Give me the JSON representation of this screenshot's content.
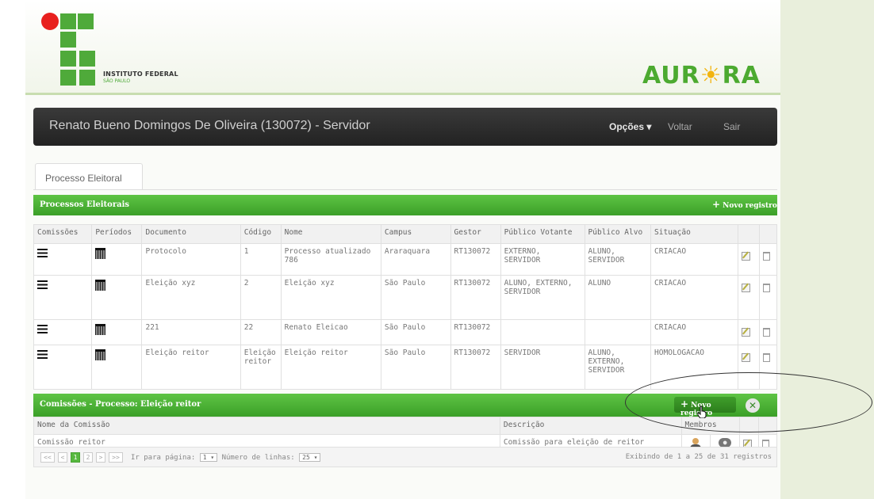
{
  "brand": {
    "institute_line1": "INSTITUTO FEDERAL",
    "institute_line2": "SÃO PAULO",
    "app_logo_left": "AUR",
    "app_logo_right": "RA",
    "colors": {
      "green": "#4faa3a",
      "red": "#e8201e",
      "sun": "#f2b411"
    }
  },
  "navbar": {
    "user": "Renato Bueno Domingos De Oliveira (130072) - Servidor",
    "options": "Opções ▾",
    "back": "Voltar",
    "exit": "Sair"
  },
  "tab": {
    "label": "Processo Eleitoral"
  },
  "processes": {
    "title": "Processos Eleitorais",
    "new_label": "Novo registro",
    "headers": [
      "Comissões",
      "Períodos",
      "Documento",
      "Código",
      "Nome",
      "Campus",
      "Gestor",
      "Público Votante",
      "Público Alvo",
      "Situação"
    ],
    "rows": [
      {
        "documento": "Protocolo",
        "codigo": "1",
        "nome": "Processo atualizado 786",
        "campus": "Araraquara",
        "gestor": "RT130072",
        "votante": "EXTERNO, SERVIDOR",
        "alvo": "ALUNO, SERVIDOR",
        "situacao": "CRIACAO"
      },
      {
        "documento": "Eleição xyz",
        "codigo": "2",
        "nome": "Eleição xyz",
        "campus": "São Paulo",
        "gestor": "RT130072",
        "votante": "ALUNO, EXTERNO, SERVIDOR",
        "alvo": "ALUNO",
        "situacao": "CRIACAO"
      },
      {
        "documento": "221",
        "codigo": "22",
        "nome": "Renato Eleicao",
        "campus": "São Paulo",
        "gestor": "RT130072",
        "votante": "",
        "alvo": "",
        "situacao": "CRIACAO"
      },
      {
        "documento": "Eleição reitor",
        "codigo": "Eleição reitor",
        "nome": "Eleição reitor",
        "campus": "São Paulo",
        "gestor": "RT130072",
        "votante": "SERVIDOR",
        "alvo": "ALUNO, EXTERNO, SERVIDOR",
        "situacao": "HOMOLOGACAO"
      }
    ]
  },
  "commissions": {
    "title": "Comissões - Processo: Eleição reitor",
    "new_label": "Novo registro",
    "close": "✕",
    "headers": [
      "Nome da Comissão",
      "Descrição",
      "Membros"
    ],
    "rows": [
      {
        "nome": "Comissão reitor",
        "descricao": "Comissão para eleição de reitor"
      }
    ]
  },
  "pager": {
    "first": "<<",
    "prev": "<",
    "page1": "1",
    "page2": "2",
    "next": ">",
    "last": ">>",
    "goto_label": "Ir para página:",
    "goto_value": "1 ▾",
    "rows_label": "Número de linhas:",
    "rows_value": "25 ▾",
    "summary": "Exibindo de 1 a 25 de 31 registros"
  }
}
